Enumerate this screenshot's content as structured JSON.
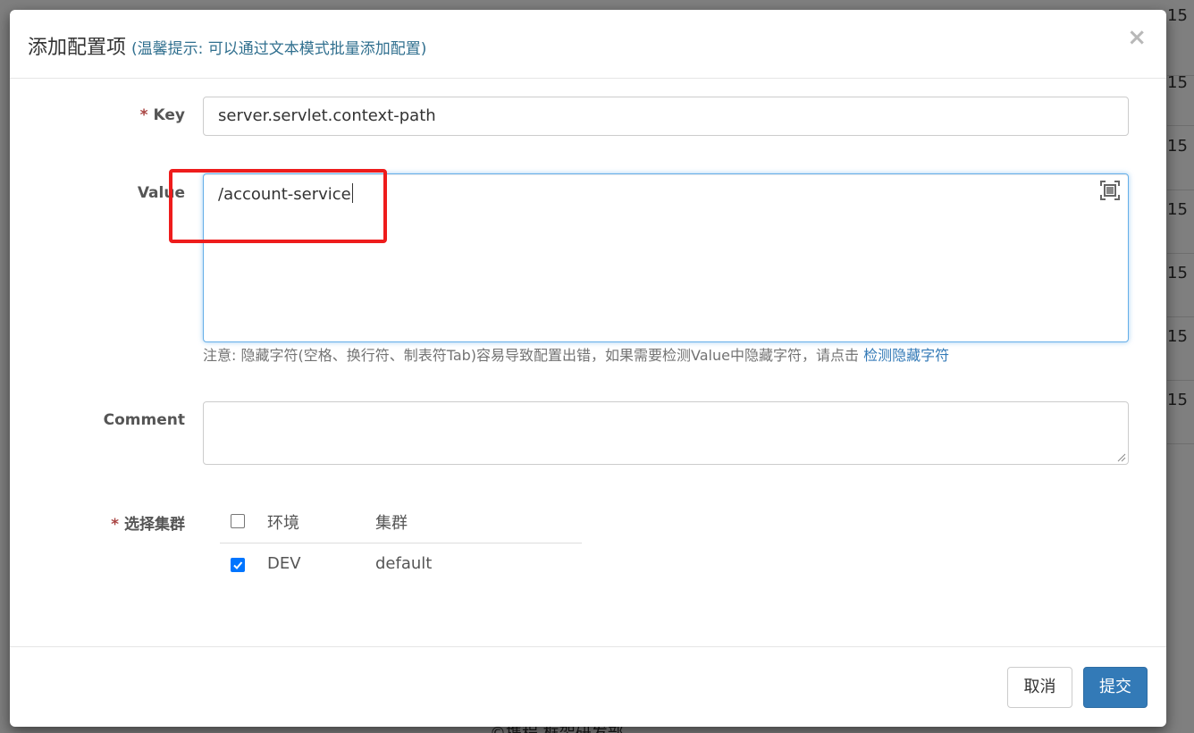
{
  "background": {
    "cells": [
      "15",
      "15",
      "15",
      "15",
      "15",
      "15",
      "15"
    ],
    "footer_text": "©携程 框架研发部"
  },
  "modal": {
    "title": "添加配置项",
    "title_hint": "(温馨提示: 可以通过文本模式批量添加配置)",
    "close_symbol": "×"
  },
  "form": {
    "key": {
      "required_mark": "*",
      "label": "Key",
      "value": "server.servlet.context-path"
    },
    "value": {
      "label": "Value",
      "value": "/account-service",
      "fullscreen_icon": "fullscreen-icon"
    },
    "help": {
      "text": "注意: 隐藏字符(空格、换行符、制表符Tab)容易导致配置出错，如果需要检测Value中隐藏字符，请点击 ",
      "link": "检测隐藏字符"
    },
    "comment": {
      "label": "Comment",
      "value": ""
    },
    "clusters": {
      "required_mark": "*",
      "label": "选择集群",
      "headers": {
        "env": "环境",
        "cluster": "集群"
      },
      "select_all_checked": false,
      "rows": [
        {
          "env": "DEV",
          "cluster": "default",
          "checked": true
        }
      ]
    }
  },
  "footer": {
    "cancel_label": "取消",
    "submit_label": "提交"
  },
  "colors": {
    "primary": "#337ab7",
    "annotation": "#ee1c1c",
    "required": "#a94442"
  }
}
